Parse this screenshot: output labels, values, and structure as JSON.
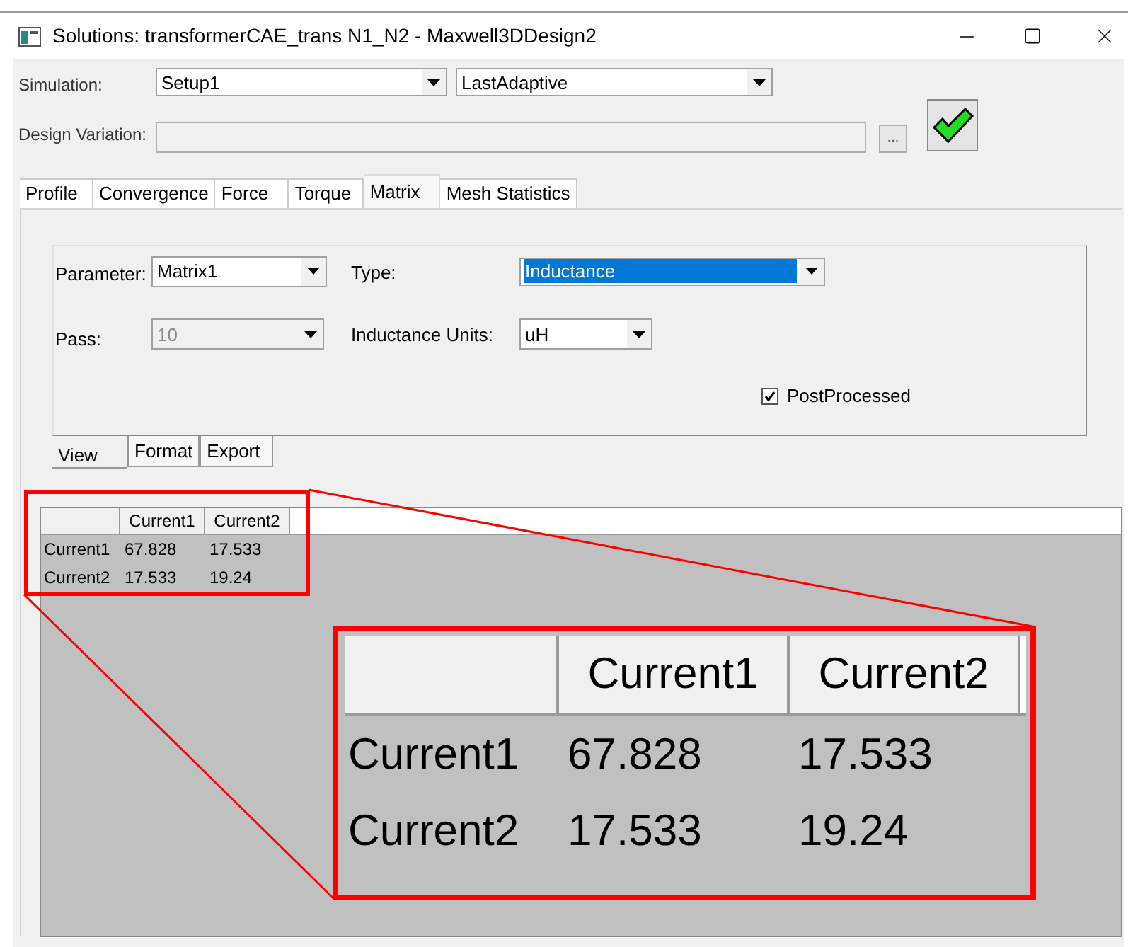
{
  "window": {
    "title": "Solutions: transformerCAE_trans N1_N2 - Maxwell3DDesign2"
  },
  "simulation": {
    "label": "Simulation:",
    "setup": "Setup1",
    "solution": "LastAdaptive"
  },
  "design_variation": {
    "label": "Design Variation:",
    "browse_button": "..."
  },
  "tabs": [
    {
      "label": "Profile",
      "selected": false
    },
    {
      "label": "Convergence",
      "selected": false
    },
    {
      "label": "Force",
      "selected": false
    },
    {
      "label": "Torque",
      "selected": false
    },
    {
      "label": "Matrix",
      "selected": true
    },
    {
      "label": "Mesh Statistics",
      "selected": false
    }
  ],
  "matrix_settings": {
    "parameter_label": "Parameter:",
    "parameter": "Matrix1",
    "type_label": "Type:",
    "type": "Inductance",
    "pass_label": "Pass:",
    "pass": "10",
    "pass_disabled": true,
    "units_label": "Inductance Units:",
    "units": "uH",
    "postprocessed": {
      "label": "PostProcessed",
      "checked": true
    }
  },
  "sub_tabs": [
    {
      "label": "View",
      "selected": true
    },
    {
      "label": "Format",
      "selected": false
    },
    {
      "label": "Export",
      "selected": false
    }
  ],
  "grid": {
    "columns": [
      "Current1",
      "Current2"
    ],
    "rows": [
      {
        "name": "Current1",
        "values": [
          "67.828",
          "17.533"
        ]
      },
      {
        "name": "Current2",
        "values": [
          "17.533",
          "19.24"
        ]
      }
    ]
  },
  "zoom_inset": {
    "columns": [
      "Current1",
      "Current2"
    ],
    "rows": [
      {
        "name": "Current1",
        "values": [
          "67.828",
          "17.533"
        ]
      },
      {
        "name": "Current2",
        "values": [
          "17.533",
          "19.24"
        ]
      }
    ]
  }
}
